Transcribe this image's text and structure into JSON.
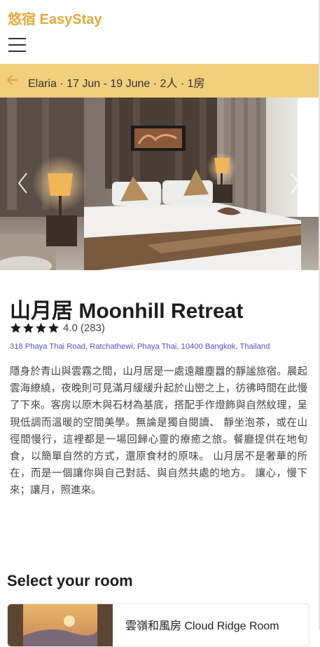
{
  "app": {
    "brand": "悠宿 EasyStay"
  },
  "icons": {
    "menu": "hamburger-icon",
    "back": "arrow-left-icon",
    "prev": "chevron-left-icon",
    "next": "chevron-right-icon",
    "star": "star-icon"
  },
  "colors": {
    "brand": "#e3a83b",
    "search_bar_bg": "#f2cf7d",
    "address_link": "#4a52c5",
    "star": "#1a1a1a"
  },
  "search": {
    "summary": "Elaria · 17 Jun - 19 June · 2人 · 1房"
  },
  "hotel": {
    "name": "山月居 Moonhill Retreat",
    "rating": "4.0",
    "rating_value": 4,
    "rating_max": 5,
    "reviews": "(283)",
    "address": "318 Phaya Thai Road, Ratchathewi, Phaya Thai, 10400 Bangkok, Thailand",
    "description": "隱身於青山與雲霧之間，山月居是一處遠離塵囂的靜謐旅宿。晨起雲海繚繞，夜晚則可見滿月緩緩升起於山巒之上，彷彿時間在此慢了下來。客房以原木與石材為基底，搭配手作燈飾與自然紋理，呈現低調而溫暖的空間美學。無論是獨自閱讀、 靜坐泡茶，或在山徑間慢行，這裡都是一場回歸心靈的療癒之旅。餐廳提供在地旬食，以簡單自然的方式，還原食材的原味。 山月居不是奢華的所在，而是一個讓你與自己對話、與自然共處的地方。 讓心，慢下來；讓月，照進來。"
  },
  "rooms": {
    "section_title": "Select your room",
    "items": [
      {
        "name": "雲嶺和風房 Cloud Ridge Room"
      }
    ]
  }
}
